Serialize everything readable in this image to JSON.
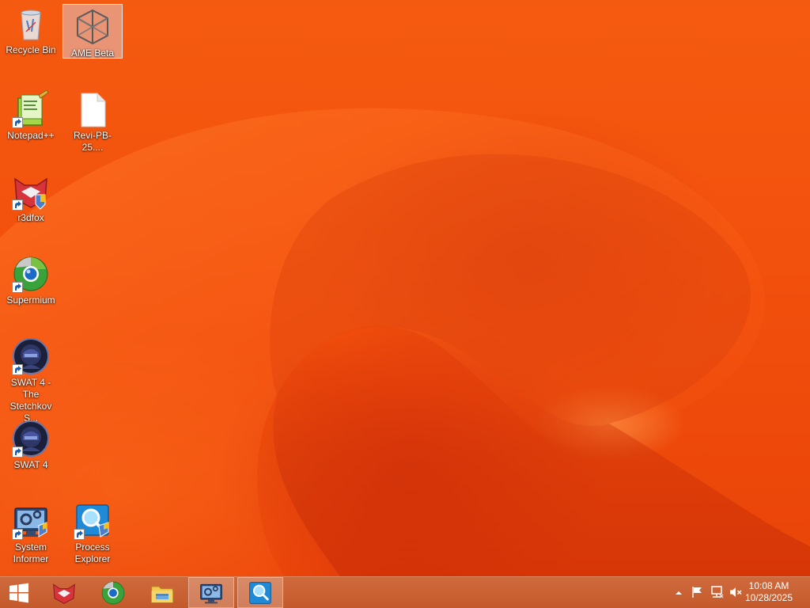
{
  "desktop": {
    "icons": [
      {
        "label": "Recycle Bin",
        "icon": "recycle-bin-icon",
        "selected": false
      },
      {
        "label": "AME Beta",
        "icon": "ame-beta-cube-icon",
        "selected": true
      },
      {
        "label": "Notepad++",
        "icon": "notepad-plus-plus-icon",
        "shortcut": true
      },
      {
        "label": "Revi-PB-25....",
        "icon": "file-icon"
      },
      {
        "label": "r3dfox",
        "icon": "r3dfox-icon",
        "shortcut": true
      },
      {
        "label": "Supermium",
        "icon": "supermium-icon",
        "shortcut": true
      },
      {
        "label": "SWAT 4 - The Stetchkov S...",
        "icon": "swat4-icon",
        "shortcut": true
      },
      {
        "label": "SWAT 4",
        "icon": "swat4-icon",
        "shortcut": true
      },
      {
        "label": "System Informer",
        "icon": "system-informer-icon",
        "shortcut": true
      },
      {
        "label": "Process Explorer",
        "icon": "process-explorer-icon",
        "shortcut": true
      }
    ]
  },
  "taskbar": {
    "start_icon": "windows-logo-icon",
    "pinned": [
      {
        "app": "r3dfox",
        "icon": "r3dfox-icon",
        "active": false
      },
      {
        "app": "Supermium",
        "icon": "supermium-icon",
        "active": false
      },
      {
        "app": "File Explorer",
        "icon": "file-explorer-icon",
        "active": false
      },
      {
        "app": "System Informer",
        "icon": "system-informer-icon",
        "active": true
      },
      {
        "app": "Process Explorer",
        "icon": "process-explorer-icon",
        "active": true
      }
    ],
    "tray": {
      "icons": [
        "show-hidden-icons-chevron-icon",
        "action-center-flag-icon",
        "network-icon",
        "volume-muted-icon"
      ],
      "time": "10:08 AM",
      "date": "10/28/2025"
    }
  },
  "colors": {
    "wallpaper": "#f2500d",
    "taskbar": "#c85e30"
  }
}
